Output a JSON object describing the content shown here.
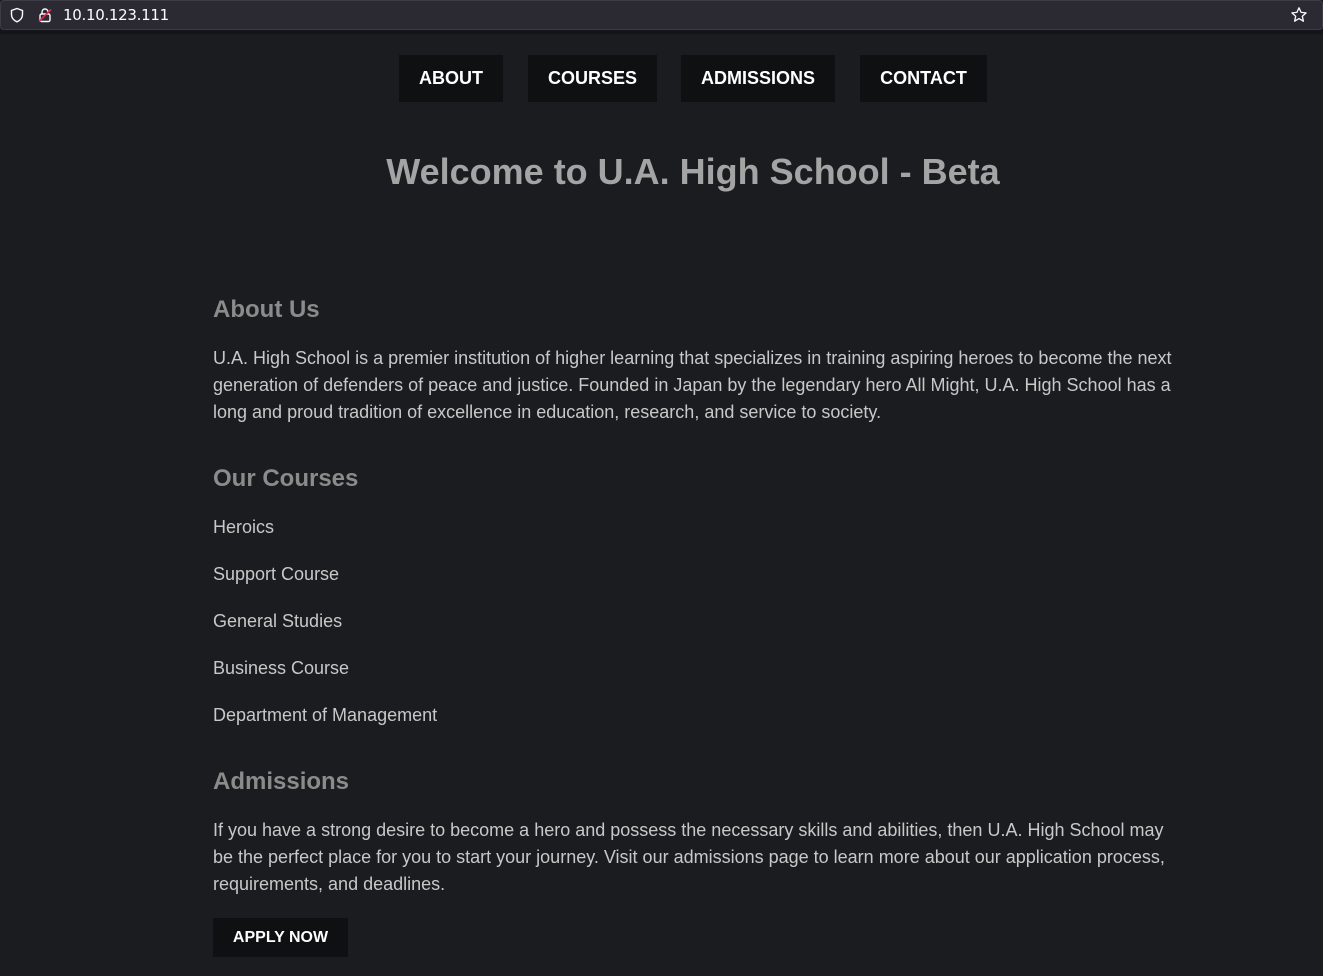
{
  "browser": {
    "url": "10.10.123.111",
    "icons": [
      "shield-icon",
      "insecure-lock-icon",
      "bookmark-star-icon"
    ]
  },
  "nav": {
    "about": "ABOUT",
    "courses": "COURSES",
    "admissions": "ADMISSIONS",
    "contact": "CONTACT"
  },
  "hero": {
    "title": "Welcome to U.A. High School - Beta"
  },
  "about": {
    "heading": "About Us",
    "text": "U.A. High School is a premier institution of higher learning that specializes in training aspiring heroes to become the next generation of defenders of peace and justice. Founded in Japan by the legendary hero All Might, U.A. High School has a long and proud tradition of excellence in education, research, and service to society."
  },
  "courses": {
    "heading": "Our Courses",
    "items": [
      "Heroics",
      "Support Course",
      "General Studies",
      "Business Course",
      "Department of Management"
    ]
  },
  "admissions": {
    "heading": "Admissions",
    "text": "If you have a strong desire to become a hero and possess the necessary skills and abilities, then U.A. High School may be the perfect place for you to start your journey. Visit our admissions page to learn more about our application process, requirements, and deadlines.",
    "button": "APPLY NOW"
  },
  "colors": {
    "background": "#1b1c1f",
    "button_bg": "#0f1012",
    "heading": "#a4a4a4",
    "text": "#c8c8c8"
  }
}
